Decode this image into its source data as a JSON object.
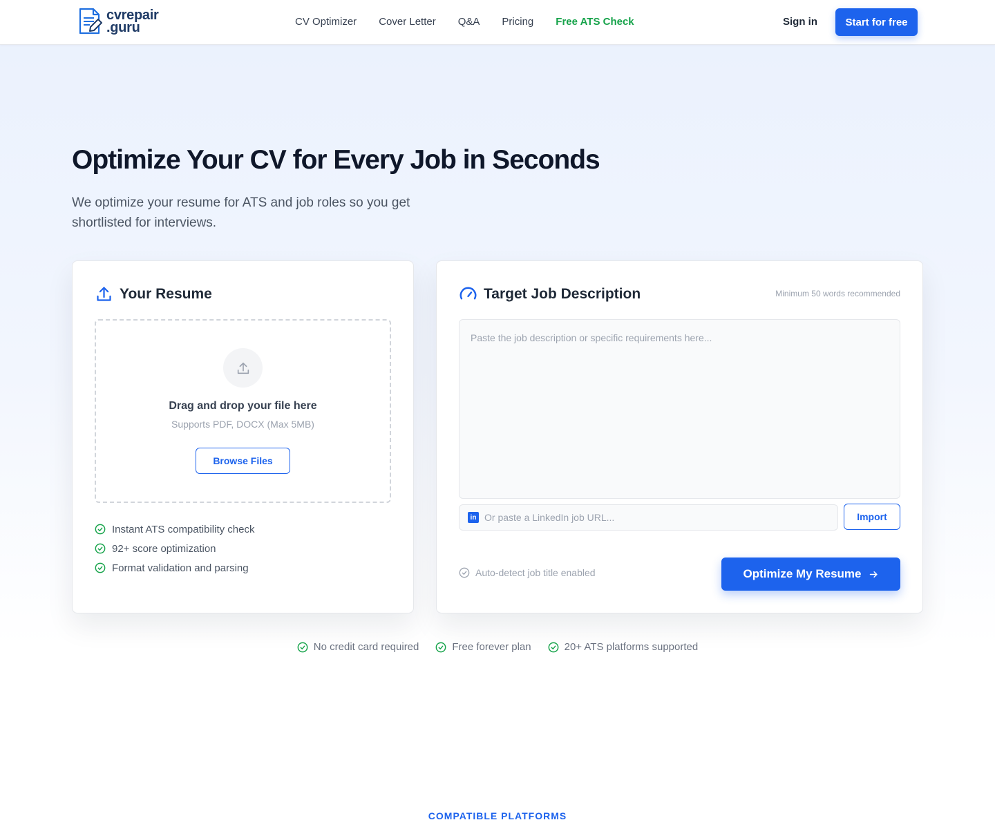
{
  "brand": {
    "line1": "cvrepair",
    "line2": ".guru"
  },
  "nav": {
    "links": [
      "CV Optimizer",
      "Cover Letter",
      "Q&A",
      "Pricing"
    ],
    "highlight_link": "Free ATS Check",
    "signin": "Sign in",
    "cta": "Start for free"
  },
  "hero": {
    "title": "Optimize Your CV for Every Job in Seconds",
    "subtitle": "We optimize your resume for ATS and job roles so you get shortlisted for interviews."
  },
  "resume_card": {
    "title": "Your Resume",
    "drop_title": "Drag and drop your file here",
    "drop_sub": "Supports PDF, DOCX (Max 5MB)",
    "browse": "Browse Files",
    "features": [
      "Instant ATS compatibility check",
      "92+ score optimization",
      "Format validation and parsing"
    ]
  },
  "job_card": {
    "title": "Target Job Description",
    "note": "Minimum 50 words recommended",
    "textarea_placeholder": "Paste the job description or specific requirements here...",
    "textarea_value": "",
    "linkedin_placeholder": "Or paste a LinkedIn job URL...",
    "linkedin_value": "",
    "import": "Import",
    "autodetect": "Auto-detect job title enabled",
    "optimize": "Optimize My Resume"
  },
  "trust": [
    "No credit card required",
    "Free forever plan",
    "20+ ATS platforms supported"
  ],
  "section_label": "COMPATIBLE PLATFORMS",
  "colors": {
    "primary": "#1d63ed",
    "success": "#16a34a",
    "navy": "#1f3b66"
  }
}
